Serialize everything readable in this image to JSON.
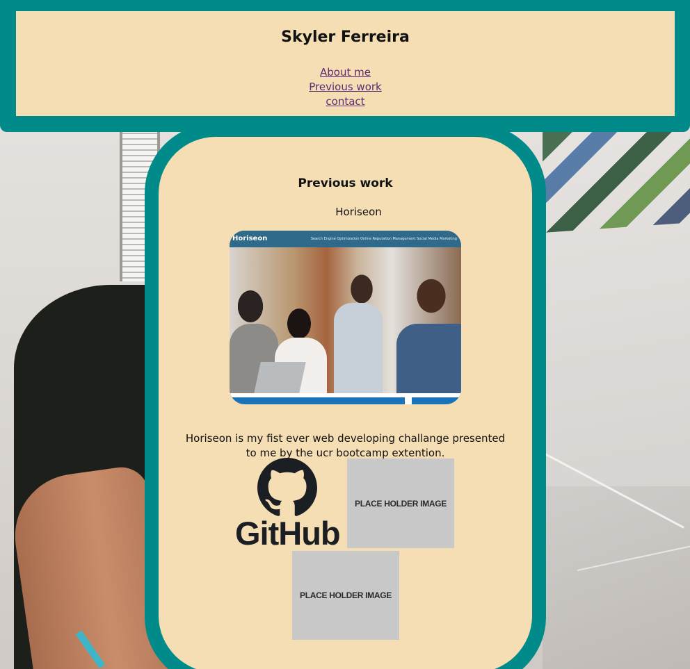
{
  "header": {
    "title": "Skyler Ferreira",
    "nav": [
      {
        "label": "About me"
      },
      {
        "label": "Previous work"
      },
      {
        "label": "contact"
      }
    ]
  },
  "main": {
    "section_title": "Previous work",
    "project": {
      "name": "Horiseon",
      "screenshot_brand": "Horiseon",
      "screenshot_nav": "Search Engine Optimization    Online Reputation Management    Social Media Marketing",
      "description": "Horiseon is my fist ever web developing challange presented to me by the ucr bootcamp extention."
    },
    "github_label": "GitHub",
    "placeholders": [
      {
        "label": "PLACE HOLDER IMAGE"
      },
      {
        "label": "PLACE HOLDER IMAGE"
      }
    ]
  },
  "colors": {
    "frame_teal": "#008a8a",
    "panel_wheat": "#f5deb3",
    "link_purple": "#5c2a78",
    "placeholder_gray": "#c8c8c8"
  }
}
